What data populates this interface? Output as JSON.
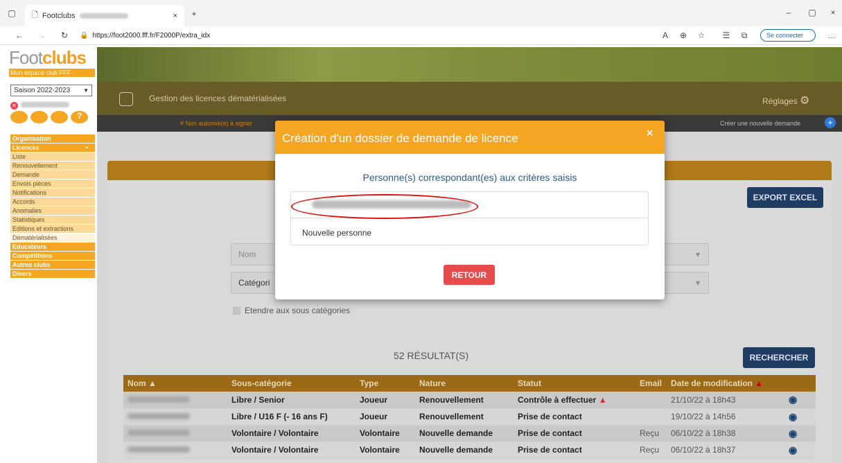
{
  "browser": {
    "tab_title": "Footclubs",
    "url": "https://foot2000.fff.fr/F2000P/extra_idx",
    "connect_label": "Se connecter"
  },
  "sidebar": {
    "logo_main": "Foot",
    "logo_bold": "clubs",
    "logo_sub": "Mon espace club FFF",
    "season": "Saison 2022-2023",
    "items": [
      {
        "label": "Organisation",
        "type": "main"
      },
      {
        "label": "Licences",
        "type": "main"
      },
      {
        "label": "Liste",
        "type": "sub"
      },
      {
        "label": "Renouvellement",
        "type": "sub"
      },
      {
        "label": "Demande",
        "type": "sub"
      },
      {
        "label": "Envois pièces",
        "type": "sub"
      },
      {
        "label": "Notifications",
        "type": "sub"
      },
      {
        "label": "Accords",
        "type": "sub"
      },
      {
        "label": "Anomalies",
        "type": "sub"
      },
      {
        "label": "Statistiques",
        "type": "sub"
      },
      {
        "label": "Editions et extractions",
        "type": "sub"
      },
      {
        "label": "Dématérialisées",
        "type": "sub-active"
      },
      {
        "label": "Educateurs",
        "type": "main"
      },
      {
        "label": "Compétitions",
        "type": "main"
      },
      {
        "label": "Autres clubs",
        "type": "main"
      },
      {
        "label": "Divers",
        "type": "main"
      }
    ]
  },
  "header": {
    "title": "Gestion des licences dématérialisées",
    "settings": "Réglages",
    "filter_tag": "# Non autorisé(e) à signer",
    "new_request": "Créer une nouvelle demande"
  },
  "search": {
    "export": "EXPORT EXCEL",
    "name_placeholder": "Nom",
    "category_placeholder": "Catégori",
    "extend": "Etendre aux sous catégories",
    "results": "52 RÉSULTAT(S)",
    "search_button": "RECHERCHER"
  },
  "table": {
    "headers": [
      "Nom ▲",
      "Sous-catégorie",
      "Type",
      "Nature",
      "Statut",
      "Email",
      "Date de modification"
    ],
    "rows": [
      {
        "sub": "Libre / Senior",
        "type": "Joueur",
        "nature": "Renouvellement",
        "status": "Contrôle à effectuer",
        "email": "",
        "date": "21/10/22 à 18h43"
      },
      {
        "sub": "Libre / U16 F (- 16 ans F)",
        "type": "Joueur",
        "nature": "Renouvellement",
        "status": "Prise de contact",
        "email": "",
        "date": "19/10/22 à 14h56"
      },
      {
        "sub": "Volontaire / Volontaire",
        "type": "Volontaire",
        "nature": "Nouvelle demande",
        "status": "Prise de contact",
        "email": "Reçu",
        "date": "06/10/22 à 18h38"
      },
      {
        "sub": "Volontaire / Volontaire",
        "type": "Volontaire",
        "nature": "Nouvelle demande",
        "status": "Prise de contact",
        "email": "Reçu",
        "date": "06/10/22 à 18h37"
      }
    ]
  },
  "modal": {
    "title": "Création d'un dossier de demande de licence",
    "subtitle": "Personne(s) correspondant(es) aux critères saisis",
    "new_person": "Nouvelle personne",
    "back": "RETOUR",
    "close": "×"
  }
}
